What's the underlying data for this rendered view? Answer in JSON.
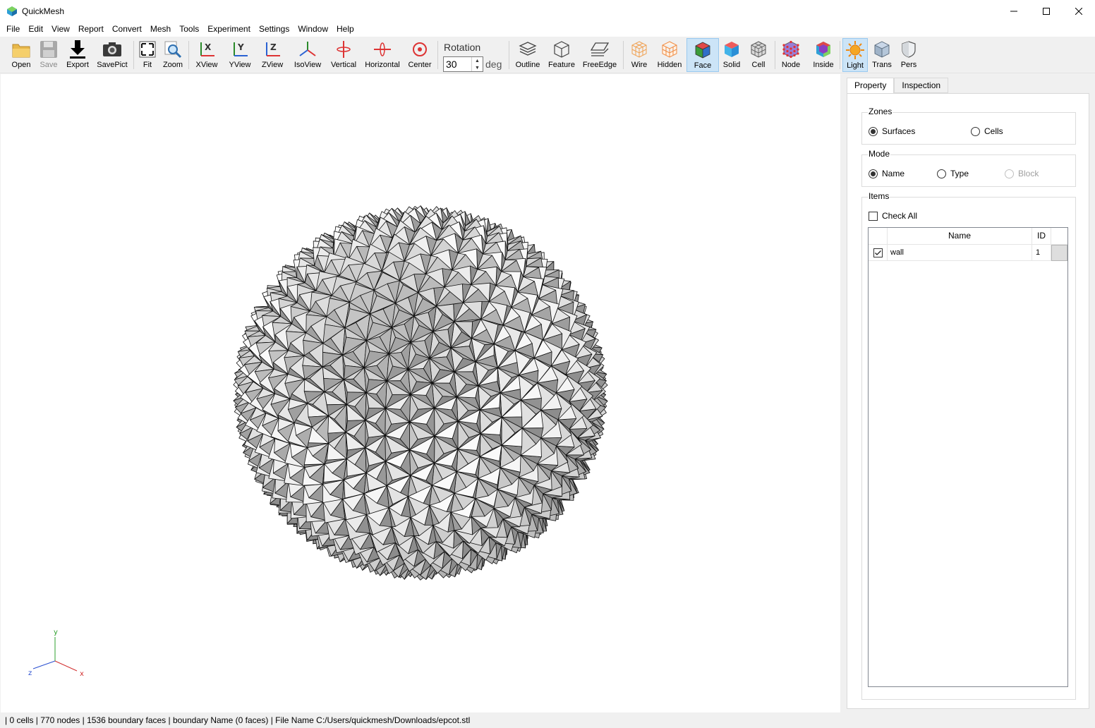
{
  "window": {
    "title": "QuickMesh"
  },
  "menu": [
    "File",
    "Edit",
    "View",
    "Report",
    "Convert",
    "Mesh",
    "Tools",
    "Experiment",
    "Settings",
    "Window",
    "Help"
  ],
  "toolbar": {
    "open": "Open",
    "save": "Save",
    "export": "Export",
    "savepict": "SavePict",
    "fit": "Fit",
    "zoom": "Zoom",
    "xview": "XView",
    "yview": "YView",
    "zview": "ZView",
    "isoview": "IsoView",
    "vertical": "Vertical",
    "horizontal": "Horizontal",
    "center": "Center",
    "rotation_label": "Rotation",
    "rotation_value": "30",
    "rotation_unit": "deg",
    "outline": "Outline",
    "feature": "Feature",
    "freeedge": "FreeEdge",
    "wire": "Wire",
    "hidden": "Hidden",
    "face": "Face",
    "solid": "Solid",
    "cell": "Cell",
    "node": "Node",
    "inside": "Inside",
    "light": "Light",
    "trans": "Trans",
    "pers": "Pers"
  },
  "axes": {
    "x": "x",
    "y": "y",
    "z": "z"
  },
  "panel": {
    "tabs": [
      "Property",
      "Inspection"
    ],
    "zones": {
      "title": "Zones",
      "surfaces": "Surfaces",
      "cells": "Cells"
    },
    "mode": {
      "title": "Mode",
      "name": "Name",
      "type": "Type",
      "block": "Block"
    },
    "items": {
      "title": "Items",
      "check_all": "Check All",
      "col_name": "Name",
      "col_id": "ID",
      "rows": [
        {
          "name": "wall",
          "id": "1",
          "checked": true
        }
      ]
    }
  },
  "status": "| 0 cells | 770 nodes | 1536 boundary faces |  boundary Name  (0 faces) | File Name C:/Users/quickmesh/Downloads/epcot.stl"
}
